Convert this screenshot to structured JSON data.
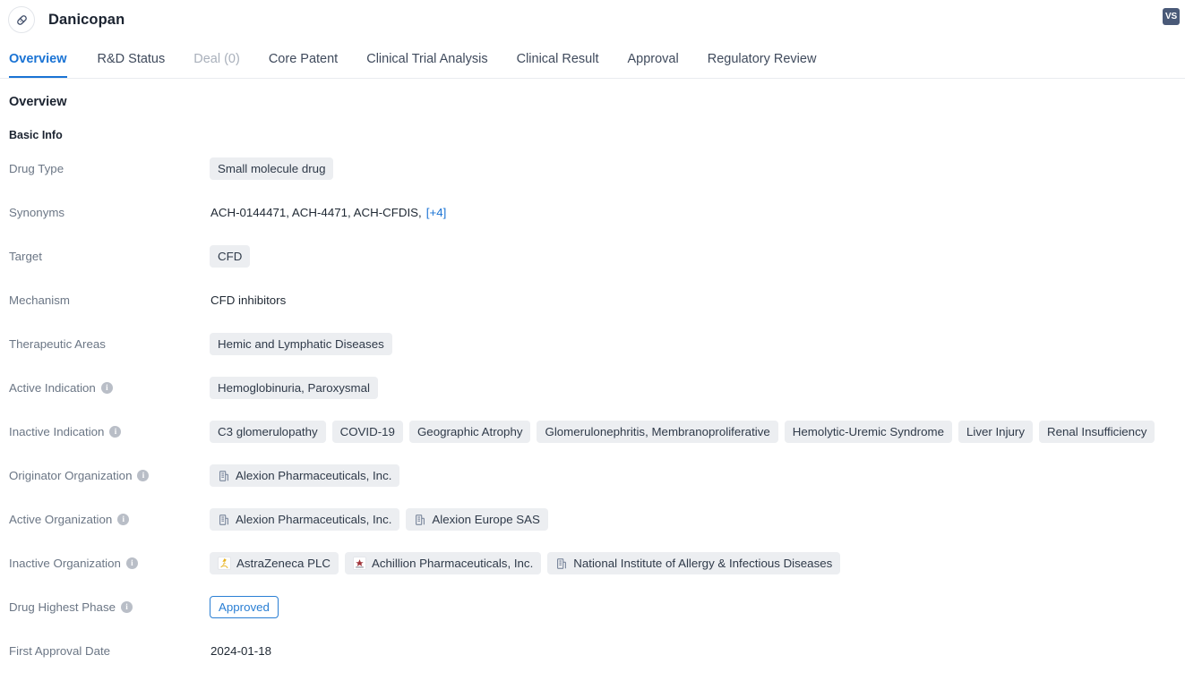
{
  "header": {
    "drug_name": "Danicopan",
    "avatar_icon": "capsule-pill-icon",
    "user_badge": "VS"
  },
  "tabs": [
    {
      "label": "Overview",
      "state": "active"
    },
    {
      "label": "R&D Status",
      "state": "normal"
    },
    {
      "label": "Deal (0)",
      "state": "disabled"
    },
    {
      "label": "Core Patent",
      "state": "normal"
    },
    {
      "label": "Clinical Trial Analysis",
      "state": "normal"
    },
    {
      "label": "Clinical Result",
      "state": "normal"
    },
    {
      "label": "Approval",
      "state": "normal"
    },
    {
      "label": "Regulatory Review",
      "state": "normal"
    }
  ],
  "page": {
    "section_title": "Overview",
    "sub_title": "Basic Info"
  },
  "fields": {
    "drug_type": {
      "label": "Drug Type",
      "tags": [
        "Small molecule drug"
      ]
    },
    "synonyms": {
      "label": "Synonyms",
      "text": "ACH-0144471,  ACH-4471,  ACH-CFDIS,",
      "more": "[+4]"
    },
    "target": {
      "label": "Target",
      "tags": [
        "CFD"
      ]
    },
    "mechanism": {
      "label": "Mechanism",
      "value": "CFD inhibitors"
    },
    "therapeutic_areas": {
      "label": "Therapeutic Areas",
      "tags": [
        "Hemic and Lymphatic Diseases"
      ]
    },
    "active_indication": {
      "label": "Active Indication",
      "has_info": true,
      "tags": [
        "Hemoglobinuria, Paroxysmal"
      ]
    },
    "inactive_indication": {
      "label": "Inactive Indication",
      "has_info": true,
      "tags": [
        "C3 glomerulopathy",
        "COVID-19",
        "Geographic Atrophy",
        "Glomerulonephritis, Membranoproliferative",
        "Hemolytic-Uremic Syndrome",
        "Liver Injury",
        "Renal Insufficiency"
      ]
    },
    "originator_organization": {
      "label": "Originator Organization",
      "has_info": true,
      "orgs": [
        {
          "name": "Alexion Pharmaceuticals, Inc.",
          "logo": "building-icon"
        }
      ]
    },
    "active_organization": {
      "label": "Active Organization",
      "has_info": true,
      "orgs": [
        {
          "name": "Alexion Pharmaceuticals, Inc.",
          "logo": "building-icon"
        },
        {
          "name": "Alexion Europe SAS",
          "logo": "building-icon"
        }
      ]
    },
    "inactive_organization": {
      "label": "Inactive Organization",
      "has_info": true,
      "orgs": [
        {
          "name": "AstraZeneca PLC",
          "logo": "astrazeneca-logo"
        },
        {
          "name": "Achillion Pharmaceuticals, Inc.",
          "logo": "achillion-logo"
        },
        {
          "name": "National Institute of Allergy & Infectious Diseases",
          "logo": "building-icon"
        }
      ]
    },
    "drug_highest_phase": {
      "label": "Drug Highest Phase",
      "has_info": true,
      "badge": "Approved"
    },
    "first_approval_date": {
      "label": "First Approval Date",
      "value": "2024-01-18"
    }
  },
  "colors": {
    "accent": "#1a73d4",
    "tag_bg": "#eceef1",
    "label_text": "#6b7685",
    "badge_bg": "#4a5a78"
  }
}
